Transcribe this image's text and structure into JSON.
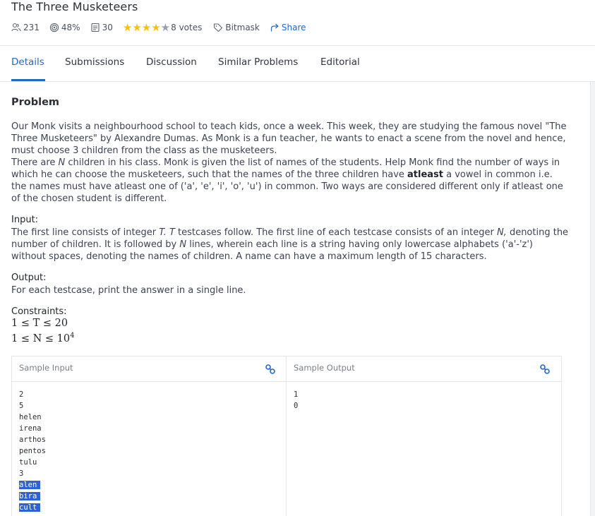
{
  "header": {
    "title": "The Three Musketeers",
    "attempts": "231",
    "accuracy": "48%",
    "solutions": "30",
    "rating": 4,
    "rating_max": 5,
    "votes": "8 votes",
    "tag": "Bitmask",
    "share": "Share"
  },
  "tabs": [
    {
      "label": "Details",
      "active": true
    },
    {
      "label": "Submissions"
    },
    {
      "label": "Discussion"
    },
    {
      "label": "Similar Problems"
    },
    {
      "label": "Editorial"
    }
  ],
  "problem": {
    "heading": "Problem",
    "p1": "Our Monk visits a neighbourhood school to teach kids, once a week. This week, they are studying the famous novel \"The Three Musketeers\" by Alexandre Dumas. As Monk is a fun teacher, he wants to enact a scene from the novel and hence, must choose 3 children from the class as the musketeers.",
    "p2_a": "There are ",
    "p2_n": "N",
    "p2_b": " children in his class. Monk is given the list of names of the students. Help Monk find the number of ways in which he can choose the musketeers, such that the names of the three children have ",
    "p2_bold": "atleast",
    "p2_c": " a vowel in common i.e. the names must have atleast one of ('a', 'e', 'i', 'o', 'u') in common. Two ways are considered different only if atleast one of the chosen student is different.",
    "input_heading": "Input:",
    "input_a": "The first line consists of integer ",
    "input_t1": "T.",
    "input_sp": " ",
    "input_t2": "T",
    "input_b": " testcases follow. The first line of each testcase consists of an integer ",
    "input_n1": "N,",
    "input_c": " denoting the number of children. It is followed by ",
    "input_n2": "N",
    "input_d": " lines, wherein each line is a string having only lowercase alphabets ('a'-'z') without spaces, denoting the names of children. A name can have a maximum length of 15 characters.",
    "output_heading": "Output:",
    "output_text": "For each testcase, print the answer in a single line.",
    "constraints_heading": "Constraints:",
    "c1": "1 ≤ T ≤ 20",
    "c2_base": "1 ≤ N ≤ 10",
    "c2_exp": "4"
  },
  "sample": {
    "input_label": "Sample Input",
    "output_label": "Sample Output",
    "input_lines": [
      "2",
      "5",
      "helen",
      "irena",
      "arthos",
      "pentos",
      "tulu",
      "3",
      "alen",
      "bira",
      "cult"
    ],
    "output_lines": [
      "1",
      "0"
    ]
  },
  "colors": {
    "accent": "#2467c4",
    "star": "#f4c20d",
    "selection": "#2b63d6"
  }
}
